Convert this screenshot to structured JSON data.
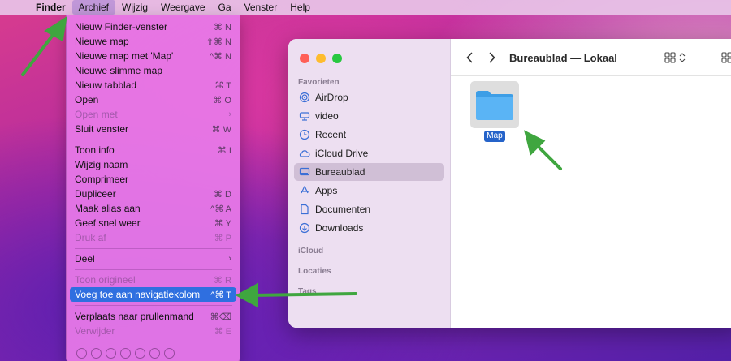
{
  "menubar": {
    "items": [
      "Finder",
      "Archief",
      "Wijzig",
      "Weergave",
      "Ga",
      "Venster",
      "Help"
    ],
    "apple_icon": "apple-logo-icon"
  },
  "dropdown": {
    "items": [
      {
        "label": "Nieuw Finder-venster",
        "shortcut": "⌘ N"
      },
      {
        "label": "Nieuwe map",
        "shortcut": "⇧⌘ N"
      },
      {
        "label": "Nieuwe map met 'Map'",
        "shortcut": "^⌘ N"
      },
      {
        "label": "Nieuwe slimme map",
        "shortcut": ""
      },
      {
        "label": "Nieuw tabblad",
        "shortcut": "⌘ T"
      },
      {
        "label": "Open",
        "shortcut": "⌘ O"
      },
      {
        "label": "Open met",
        "shortcut": "›"
      },
      {
        "label": "Sluit venster",
        "shortcut": "⌘ W"
      },
      {
        "label": "Toon info",
        "shortcut": "⌘ I"
      },
      {
        "label": "Wijzig naam",
        "shortcut": ""
      },
      {
        "label": "Comprimeer",
        "shortcut": ""
      },
      {
        "label": "Dupliceer",
        "shortcut": "⌘ D"
      },
      {
        "label": "Maak alias aan",
        "shortcut": "^⌘ A"
      },
      {
        "label": "Geef snel weer",
        "shortcut": "⌘ Y"
      },
      {
        "label": "Druk af",
        "shortcut": "⌘ P"
      },
      {
        "label": "Deel",
        "shortcut": "›"
      },
      {
        "label": "Toon origineel",
        "shortcut": "⌘ R"
      },
      {
        "label": "Voeg toe aan navigatiekolom",
        "shortcut": "^⌘ T"
      },
      {
        "label": "Verplaats naar prullenmand",
        "shortcut": "⌘⌫"
      },
      {
        "label": "Verwijder",
        "shortcut": "⌘ E"
      }
    ],
    "tag_colors": [
      "none",
      "none",
      "none",
      "none",
      "none",
      "none",
      "none"
    ]
  },
  "finder": {
    "title": "Bureaublad — Lokaal",
    "sections": {
      "favorites": "Favorieten",
      "icloud": "iCloud",
      "locations": "Locaties",
      "tags": "Tags"
    },
    "sidebar_items": [
      {
        "label": "AirDrop",
        "icon": "airdrop-icon"
      },
      {
        "label": "video",
        "icon": "drive-icon"
      },
      {
        "label": "Recent",
        "icon": "clock-icon"
      },
      {
        "label": "iCloud Drive",
        "icon": "cloud-icon"
      },
      {
        "label": "Bureaublad",
        "icon": "desktop-icon"
      },
      {
        "label": "Apps",
        "icon": "apps-icon"
      },
      {
        "label": "Documenten",
        "icon": "document-icon"
      },
      {
        "label": "Downloads",
        "icon": "download-icon"
      }
    ],
    "folder": {
      "label": "Map"
    }
  },
  "colors": {
    "accent": "#2f6fe0",
    "arrow": "#3fa63f",
    "folder": "#5ab4f5"
  }
}
